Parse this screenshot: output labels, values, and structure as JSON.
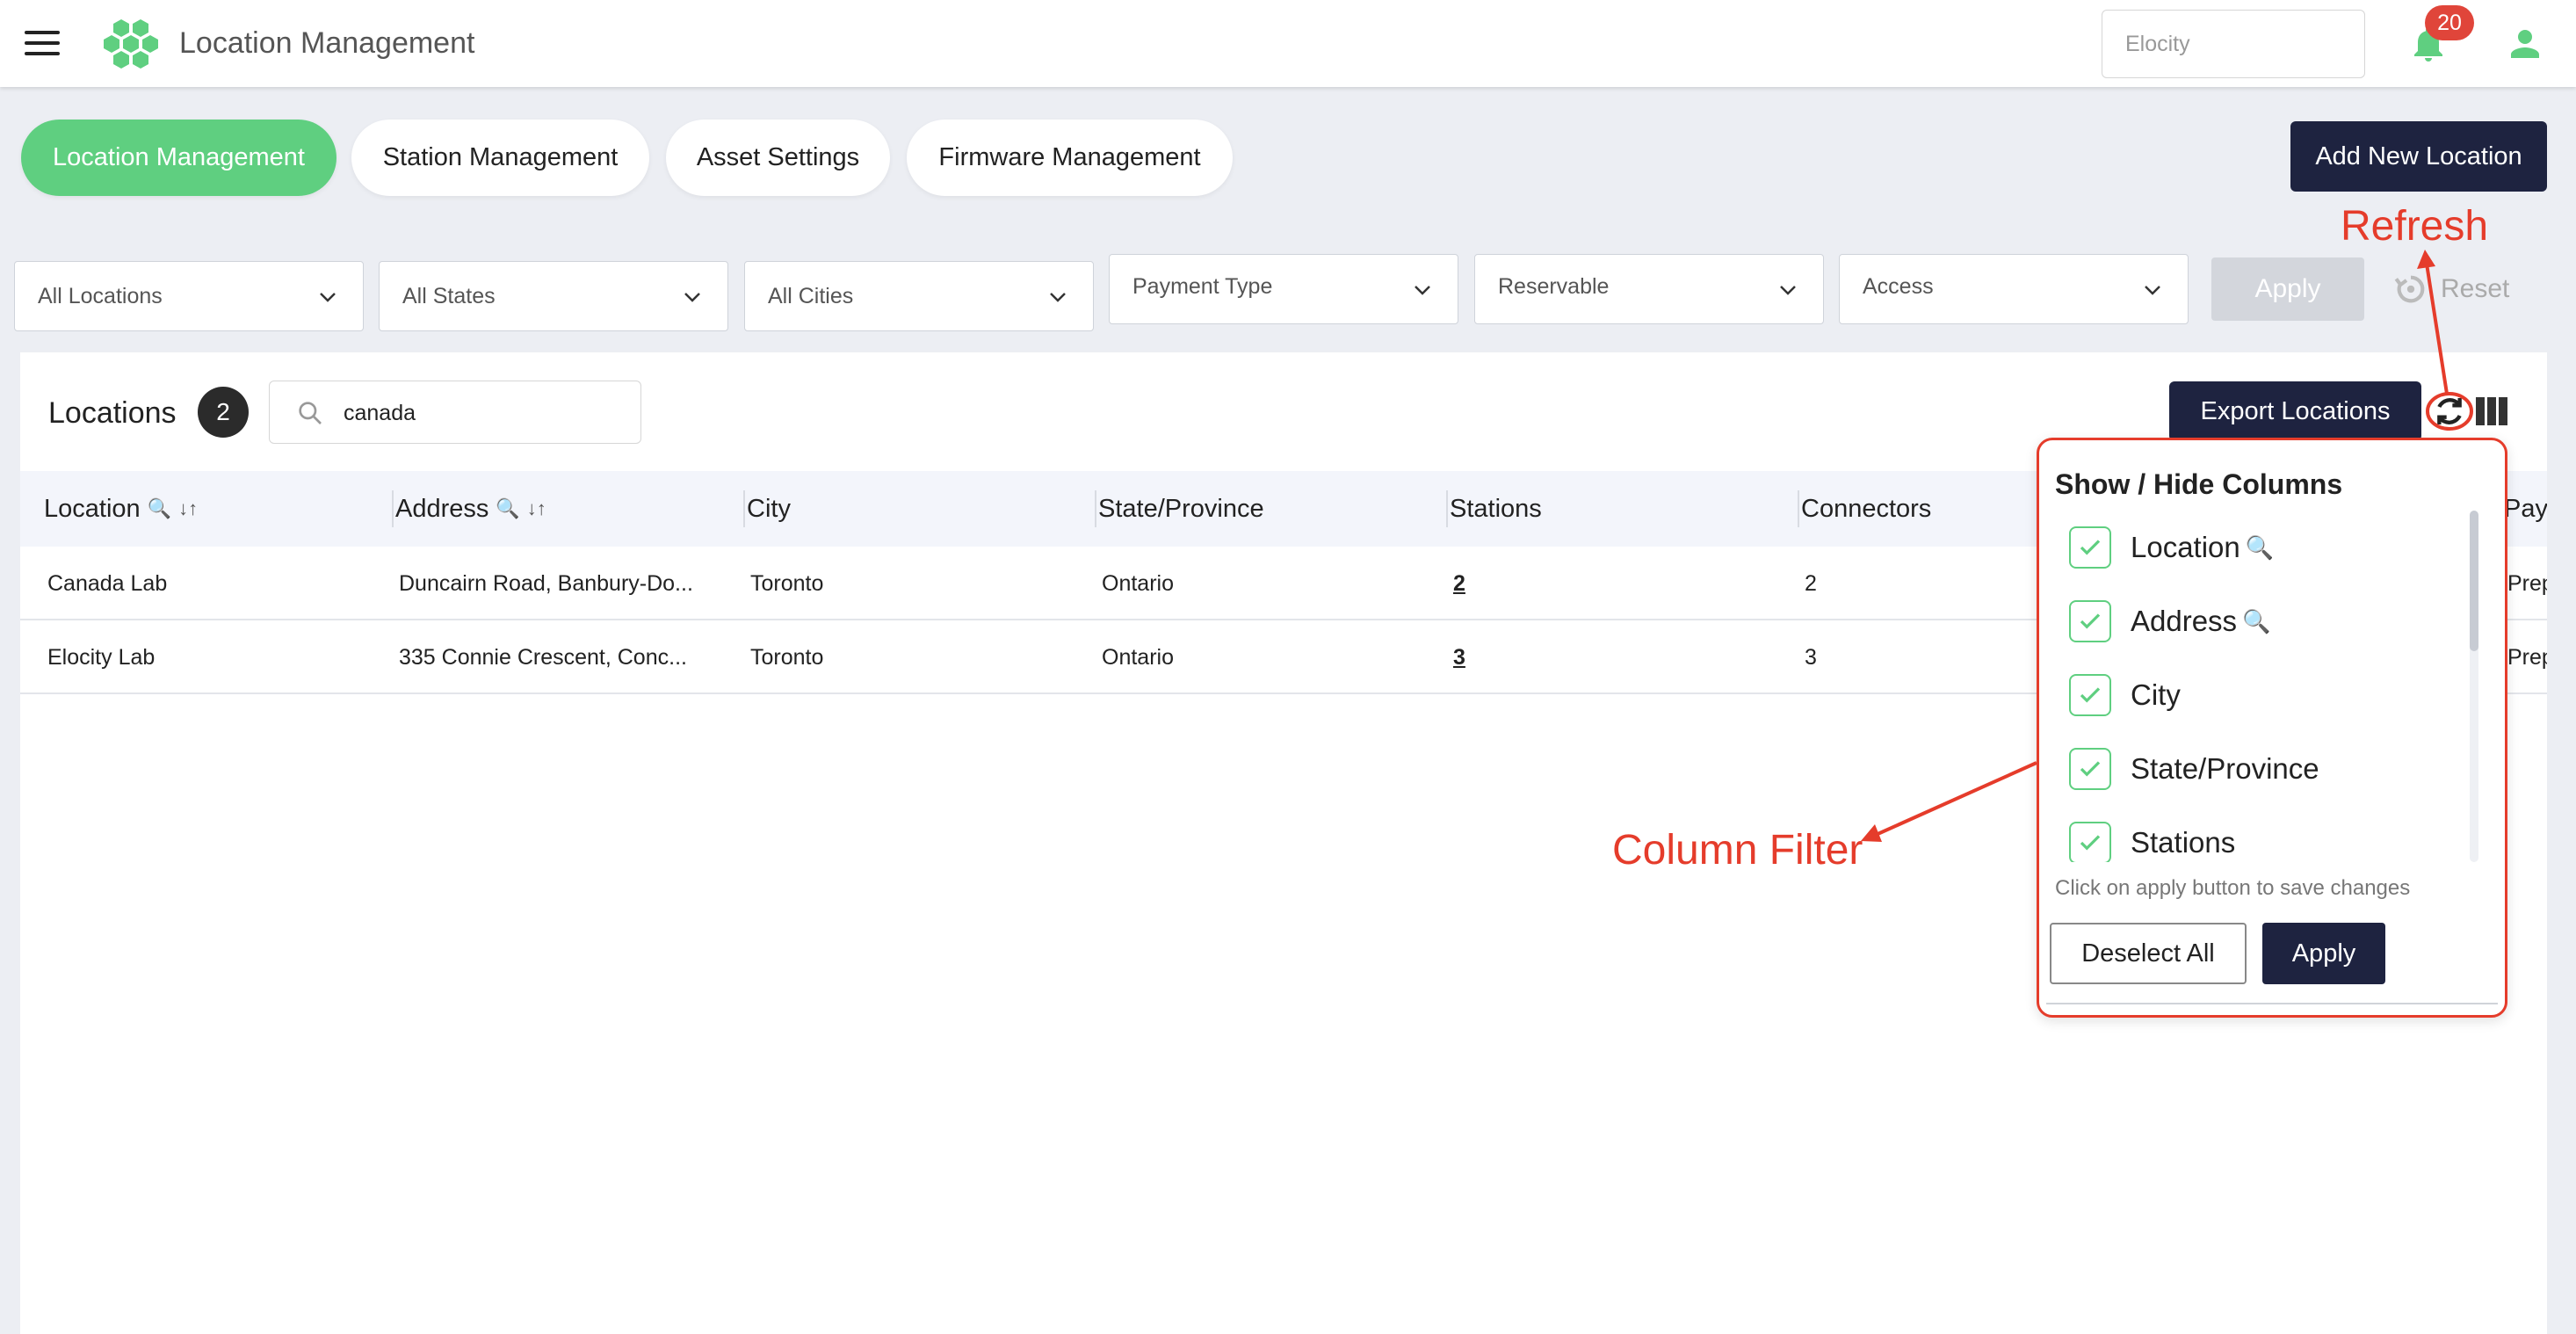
{
  "app": {
    "title": "Location Management",
    "tenant_placeholder": "Elocity",
    "notification_count": "20"
  },
  "tabs": [
    {
      "label": "Location Management",
      "active": true
    },
    {
      "label": "Station Management",
      "active": false
    },
    {
      "label": "Asset Settings",
      "active": false
    },
    {
      "label": "Firmware Management",
      "active": false
    }
  ],
  "actions": {
    "add_location": "Add New Location"
  },
  "filters": {
    "locations": "All Locations",
    "states": "All States",
    "cities": "All Cities",
    "payment_type": "Payment Type",
    "reservable": "Reservable",
    "access": "Access",
    "apply": "Apply",
    "reset": "Reset"
  },
  "list": {
    "title": "Locations",
    "count": "2",
    "search_value": "canada",
    "export_label": "Export Locations",
    "columns": [
      {
        "label": "Location",
        "search": true,
        "sort": true
      },
      {
        "label": "Address",
        "search": true,
        "sort": true
      },
      {
        "label": "City"
      },
      {
        "label": "State/Province"
      },
      {
        "label": "Stations"
      },
      {
        "label": "Connectors"
      },
      {
        "label": "Pay"
      }
    ],
    "tools": {
      "search_glyph": "🔍",
      "sort_glyph": "↓↑"
    },
    "rows": [
      {
        "location": "Canada Lab",
        "address": "Duncairn Road, Banbury-Do...",
        "city": "Toronto",
        "state": "Ontario",
        "stations": "2",
        "connectors": "2",
        "payment": "Prep"
      },
      {
        "location": "Elocity Lab",
        "address": "335 Connie Crescent, Conc...",
        "city": "Toronto",
        "state": "Ontario",
        "stations": "3",
        "connectors": "3",
        "payment": "Prep"
      }
    ]
  },
  "column_popover": {
    "title": "Show / Hide Columns",
    "items": [
      {
        "label": "Location",
        "checked": true,
        "icon": "🔍"
      },
      {
        "label": "Address",
        "checked": true,
        "icon": "🔍"
      },
      {
        "label": "City",
        "checked": true,
        "icon": ""
      },
      {
        "label": "State/Province",
        "checked": true,
        "icon": ""
      },
      {
        "label": "Stations",
        "checked": true,
        "icon": ""
      }
    ],
    "hint": "Click on apply button to save changes",
    "deselect_label": "Deselect All",
    "apply_label": "Apply"
  },
  "annotations": {
    "refresh": "Refresh",
    "column_filter": "Column Filter"
  },
  "colors": {
    "accent_green": "#5fcf80",
    "navy": "#1e2340",
    "annotation_red": "#e53c2b",
    "badge_red": "#e0453a"
  }
}
